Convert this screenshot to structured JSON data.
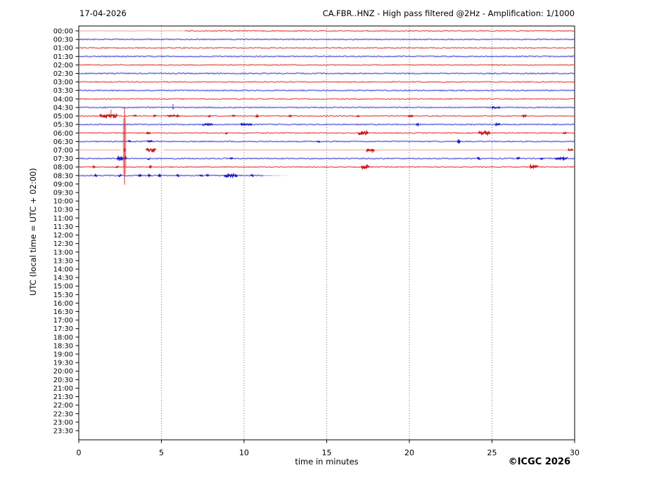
{
  "chart_data": {
    "type": "line",
    "variant": "helicorder-dayplot",
    "title_left": "17-04-2026",
    "title_right": "CA.FBR..HNZ - High pass filtered @2Hz - Amplification: 1/1000",
    "xlabel": "time in minutes",
    "ylabel": "UTC (local time = UTC + 02:00)",
    "copyright": "©ICGC 2026",
    "xlim": [
      0,
      30
    ],
    "xticks": [
      0,
      5,
      10,
      15,
      20,
      25,
      30
    ],
    "grid_x": [
      5,
      10,
      15,
      20,
      25
    ],
    "grid_on": true,
    "row_interval_minutes": 30,
    "row_labels": [
      "00:00",
      "00:30",
      "01:00",
      "01:30",
      "02:00",
      "02:30",
      "03:00",
      "03:30",
      "04:00",
      "04:30",
      "05:00",
      "05:30",
      "06:00",
      "06:30",
      "07:00",
      "07:30",
      "08:00",
      "08:30",
      "09:00",
      "09:30",
      "10:00",
      "10:30",
      "11:00",
      "11:30",
      "12:00",
      "12:30",
      "13:00",
      "13:30",
      "14:00",
      "14:30",
      "15:00",
      "15:30",
      "16:00",
      "16:30",
      "17:00",
      "17:30",
      "18:00",
      "18:30",
      "19:00",
      "19:30",
      "20:00",
      "20:30",
      "21:00",
      "21:30",
      "22:00",
      "22:30",
      "23:00",
      "23:30"
    ],
    "colors": {
      "red": "#e64646",
      "red_dark": "#c81212",
      "blue": "#4646dc",
      "blue_dark": "#1414be",
      "pink": "#f5a9a9",
      "grid": "#333333",
      "frame": "#000000"
    },
    "traces": [
      {
        "label": "00:00",
        "color": "red",
        "start": 0,
        "end": 30,
        "light_until": 6.4,
        "blobs": []
      },
      {
        "label": "00:30",
        "color": "blue",
        "start": 0,
        "end": 30,
        "blobs": []
      },
      {
        "label": "01:00",
        "color": "red",
        "start": 0,
        "end": 30,
        "blobs": []
      },
      {
        "label": "01:30",
        "color": "blue",
        "start": 0,
        "end": 30,
        "blobs": []
      },
      {
        "label": "02:00",
        "color": "red",
        "start": 0,
        "end": 30,
        "blobs": []
      },
      {
        "label": "02:30",
        "color": "blue",
        "start": 0,
        "end": 30,
        "blobs": []
      },
      {
        "label": "03:00",
        "color": "red",
        "start": 0,
        "end": 30,
        "blobs": []
      },
      {
        "label": "03:30",
        "color": "blue",
        "start": 0,
        "end": 30,
        "blobs": []
      },
      {
        "label": "04:00",
        "color": "red",
        "start": 0,
        "end": 30,
        "blobs": []
      },
      {
        "label": "04:30",
        "color": "blue",
        "start": 0,
        "end": 30,
        "blobs": [
          [
            25.0,
            25.5,
            1
          ]
        ],
        "spikes": [
          [
            5.7,
            5,
            3
          ]
        ]
      },
      {
        "label": "05:00",
        "color": "red",
        "start": 0,
        "end": 30,
        "blobs": [
          [
            1.25,
            2.35,
            2
          ],
          [
            3.3,
            3.5,
            1
          ],
          [
            4.5,
            4.7,
            1
          ],
          [
            5.35,
            6.1,
            1
          ],
          [
            7.8,
            8.0,
            1
          ],
          [
            9.3,
            9.5,
            1
          ],
          [
            10.7,
            10.9,
            1
          ],
          [
            12.7,
            12.9,
            1
          ],
          [
            16.8,
            17.0,
            1
          ],
          [
            19.9,
            20.2,
            1
          ],
          [
            26.8,
            27.1,
            1
          ]
        ],
        "spikes": [
          [
            1.95,
            9,
            3
          ]
        ]
      },
      {
        "label": "05:30",
        "color": "blue",
        "start": 0,
        "end": 30,
        "blobs": [
          [
            7.5,
            8.1,
            1
          ],
          [
            9.8,
            10.5,
            1
          ],
          [
            20.4,
            20.6,
            1
          ],
          [
            25.2,
            25.5,
            1
          ]
        ]
      },
      {
        "label": "06:00",
        "color": "red",
        "start": 0,
        "end": 30,
        "blobs": [
          [
            4.1,
            4.35,
            1
          ],
          [
            8.85,
            9.0,
            1
          ],
          [
            16.9,
            17.5,
            2
          ],
          [
            24.2,
            24.9,
            2
          ],
          [
            29.3,
            29.5,
            1
          ]
        ]
      },
      {
        "label": "06:30",
        "color": "blue",
        "start": 0,
        "end": 30,
        "blobs": [
          [
            3.0,
            3.15,
            1
          ],
          [
            4.15,
            4.45,
            1
          ],
          [
            14.4,
            14.6,
            1
          ],
          [
            22.9,
            23.1,
            1
          ]
        ]
      },
      {
        "label": "07:00",
        "color": "pink-red",
        "start": 0,
        "end": 30,
        "gaps": [
          [
            2.55,
            5.15
          ]
        ],
        "blobs": [
          [
            4.05,
            4.7,
            2
          ],
          [
            17.4,
            17.9,
            2
          ],
          [
            29.6,
            29.9,
            1
          ]
        ]
      },
      {
        "label": "07:30",
        "color": "blue",
        "start": 0,
        "end": 30,
        "blobs": [
          [
            2.3,
            2.95,
            2
          ],
          [
            4.15,
            4.3,
            1
          ],
          [
            9.15,
            9.35,
            1
          ],
          [
            24.1,
            24.3,
            1
          ],
          [
            26.5,
            26.7,
            1
          ],
          [
            27.9,
            28.1,
            1
          ],
          [
            28.8,
            29.6,
            1
          ]
        ]
      },
      {
        "label": "08:00",
        "color": "red",
        "start": 0,
        "end": 30,
        "blobs": [
          [
            0.85,
            1.0,
            1
          ],
          [
            2.25,
            2.4,
            1
          ],
          [
            4.25,
            4.4,
            1
          ],
          [
            17.1,
            17.6,
            2
          ],
          [
            27.3,
            27.8,
            2
          ]
        ]
      },
      {
        "label": "08:30",
        "color": "blue",
        "start": 0,
        "end": 12.7,
        "fade_from": 11.2,
        "blobs": [
          [
            0.95,
            1.1,
            1
          ],
          [
            2.4,
            2.6,
            1
          ],
          [
            3.6,
            3.8,
            1
          ],
          [
            4.2,
            4.4,
            1
          ],
          [
            4.8,
            5.0,
            1
          ],
          [
            5.9,
            6.1,
            1
          ],
          [
            7.3,
            7.5,
            1
          ],
          [
            7.7,
            7.9,
            1
          ],
          [
            8.8,
            9.6,
            2
          ],
          [
            10.4,
            10.6,
            1
          ]
        ]
      }
    ],
    "main_event": {
      "row_label": "07:00",
      "x_min": 2.77,
      "clipped": true,
      "span_rows": [
        "04:30",
        "08:30"
      ]
    }
  }
}
